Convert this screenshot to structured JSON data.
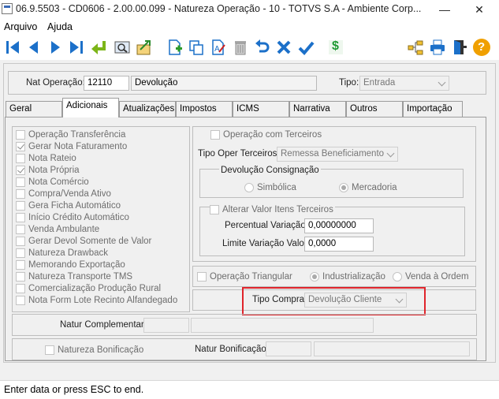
{
  "window": {
    "title": "06.9.5503 - CD0606 - 2.00.00.099 - Natureza Operação - 10 - TOTVS S.A - Ambiente Corp...",
    "minimize": "—",
    "close": "✕"
  },
  "menu": {
    "file": "Arquivo",
    "help": "Ajuda"
  },
  "toolbar": {
    "icons": [
      "first-record-icon",
      "previous-record-icon",
      "next-record-icon",
      "last-record-icon",
      "return-icon",
      "search-icon",
      "export-icon",
      "new-icon",
      "copy-icon",
      "edit-icon",
      "delete-icon",
      "undo-icon",
      "cancel-icon",
      "confirm-icon",
      "dollar-icon",
      "tree-icon",
      "print-icon",
      "exit-icon",
      "help-icon"
    ],
    "dollar_symbol": "$",
    "help_symbol": "?"
  },
  "header": {
    "nat_label": "Nat Operação:",
    "nat_code": "12110",
    "nat_desc": "Devolução",
    "tipo_label": "Tipo:",
    "tipo_value": "Entrada"
  },
  "tabs": [
    "Geral",
    "Adicionais",
    "Atualizações",
    "Impostos",
    "ICMS",
    "Narrativa",
    "Outros",
    "Importação"
  ],
  "options": [
    {
      "label": "Operação Transferência",
      "checked": false
    },
    {
      "label": "Gerar Nota Faturamento",
      "checked": true
    },
    {
      "label": "Nota Rateio",
      "checked": false
    },
    {
      "label": "Nota Própria",
      "checked": true
    },
    {
      "label": "Nota Comércio",
      "checked": false
    },
    {
      "label": "Compra/Venda Ativo",
      "checked": false
    },
    {
      "label": "Gera Ficha Automático",
      "checked": false
    },
    {
      "label": "Início Crédito Automático",
      "checked": false
    },
    {
      "label": "Venda Ambulante",
      "checked": false
    },
    {
      "label": "Gerar Devol Somente de Valor",
      "checked": false
    },
    {
      "label": "Natureza Drawback",
      "checked": false
    },
    {
      "label": "Memorando Exportação",
      "checked": false
    },
    {
      "label": "Natureza Transporte TMS",
      "checked": false
    },
    {
      "label": "Comercialização Produção Rural",
      "checked": false
    },
    {
      "label": "Nota Form Lote Recinto Alfandegado",
      "checked": false
    }
  ],
  "terceiros": {
    "op_label": "Operação com Terceiros",
    "tipo_label": "Tipo Oper Terceiros:",
    "tipo_value": "Remessa Beneficiamento",
    "consig_title": "Devolução Consignação",
    "radio_simbolica": "Simbólica",
    "radio_mercadoria": "Mercadoria",
    "alterar_label": "Alterar Valor Itens Terceiros",
    "perc_label": "Percentual Variação:",
    "perc_value": "0,00000000",
    "limite_label": "Limite Variação Valor:",
    "limite_value": "0,0000"
  },
  "triangular": {
    "label": "Operação Triangular",
    "industrializacao": "Industrialização",
    "venda_ordem": "Venda à Ordem"
  },
  "tipo_compra": {
    "label": "Tipo Compra:",
    "value": "Devolução Cliente"
  },
  "natur_complementar": {
    "label": "Natur Complementar:"
  },
  "bonificacao": {
    "chk_label": "Natureza Bonificação",
    "natur_label": "Natur Bonificação:"
  },
  "status": {
    "text": "Enter data or press ESC to end."
  },
  "colors": {
    "highlight": "#e0242b",
    "toolbar_blue": "#1c70c9",
    "help_orange": "#f0a000"
  }
}
